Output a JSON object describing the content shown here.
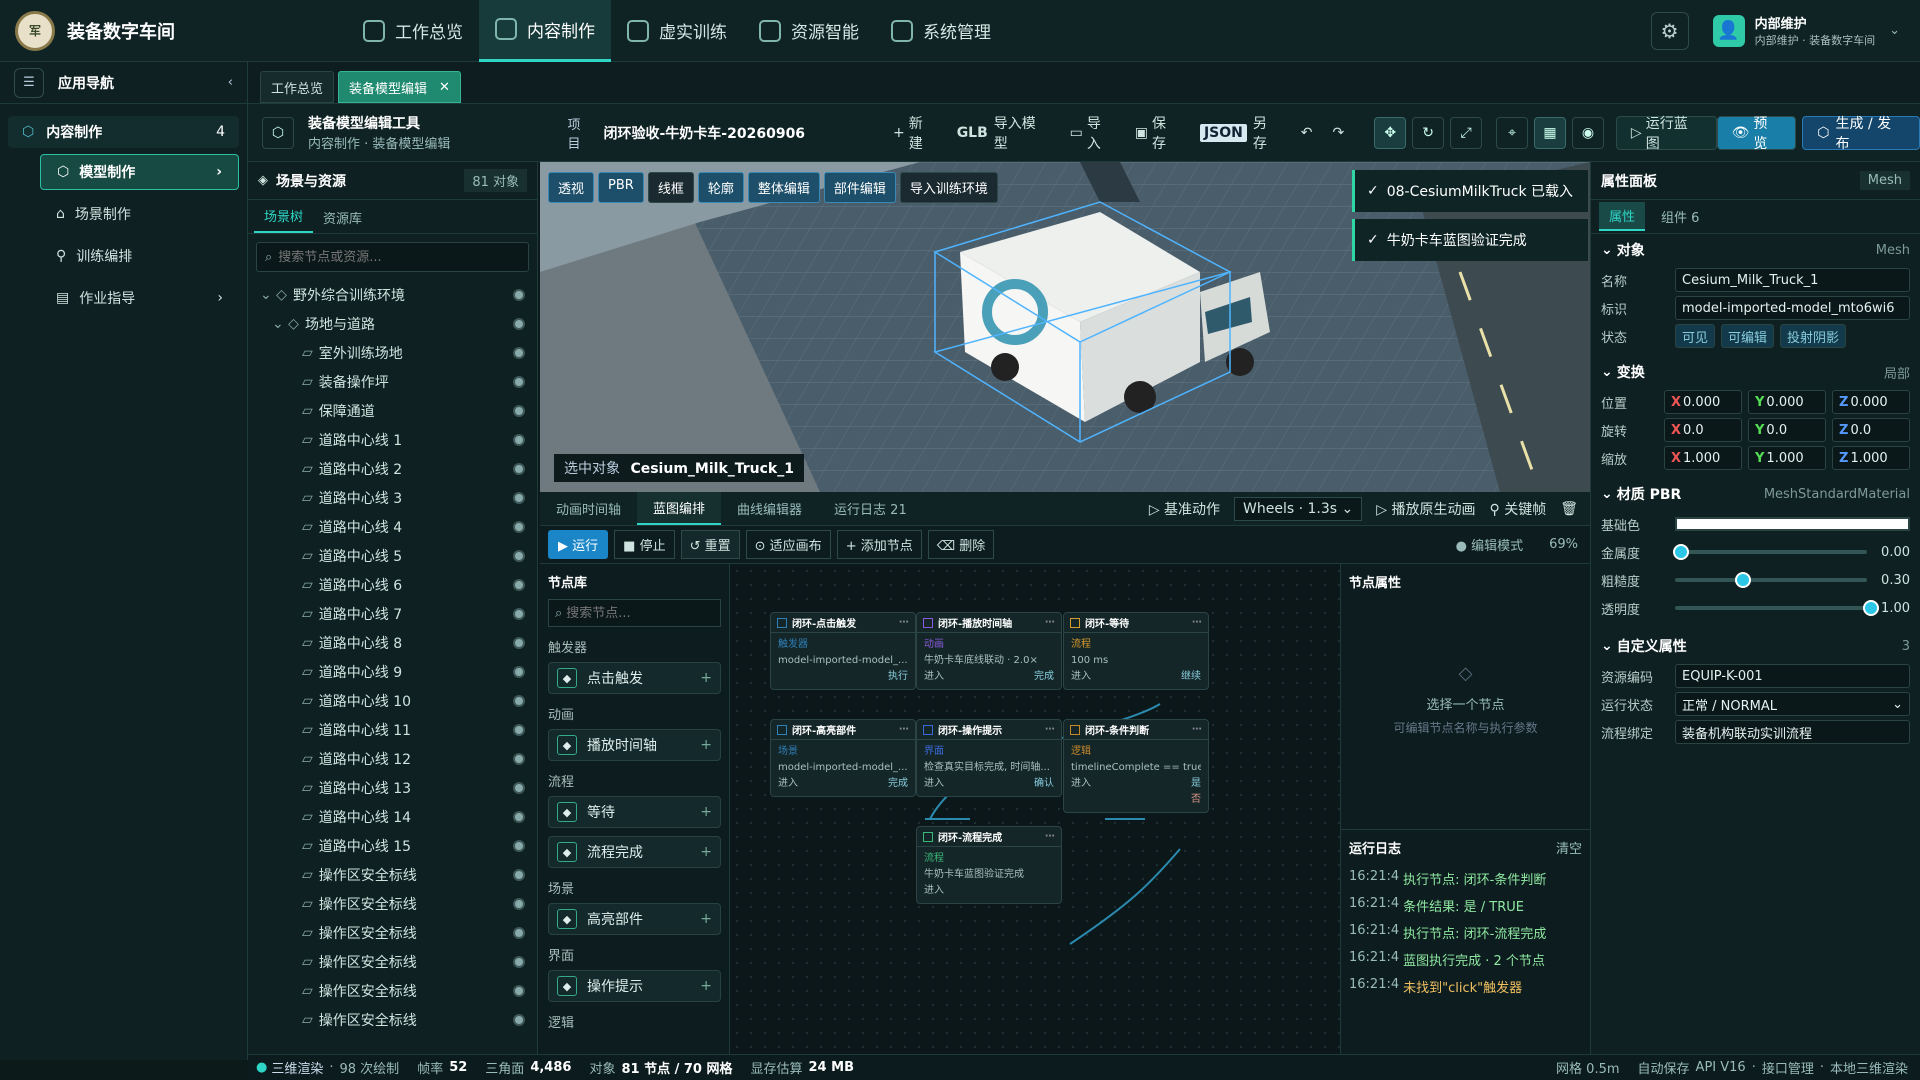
{
  "app": {
    "title": "装备数字车间",
    "logo": "军"
  },
  "topnav": [
    {
      "label": "工作总览"
    },
    {
      "label": "内容制作"
    },
    {
      "label": "虚实训练"
    },
    {
      "label": "资源智能"
    },
    {
      "label": "系统管理"
    }
  ],
  "user": {
    "name": "内部维护",
    "sub": "内部维护 · 装备数字车间"
  },
  "sidebar": {
    "title": "应用导航",
    "group": "内容制作",
    "group_count": "4",
    "items": [
      {
        "label": "模型制作"
      },
      {
        "label": "场景制作"
      },
      {
        "label": "训练编排"
      },
      {
        "label": "作业指导"
      }
    ]
  },
  "tabs": [
    {
      "label": "工作总览"
    },
    {
      "label": "装备模型编辑"
    }
  ],
  "tool": {
    "title": "装备模型编辑工具",
    "crumb": "内容制作 · 装备模型编辑",
    "project_label": "项目",
    "project": "闭环验收-牛奶卡车-20260906",
    "new": "新建",
    "glb": "GLB",
    "glb_import": "导入模型",
    "import": "导入",
    "save": "保存",
    "json": "JSON",
    "saveas": "另存",
    "run_bp": "运行蓝图",
    "preview": "预览",
    "publish": "生成 / 发布"
  },
  "scene": {
    "title": "场景与资源",
    "count": "81 对象",
    "tab1": "场景树",
    "tab2": "资源库",
    "search": "搜索节点或资源...",
    "tree": [
      "野外综合训练环境",
      "场地与道路",
      "室外训练场地",
      "装备操作坪",
      "保障通道",
      "道路中心线 1",
      "道路中心线 2",
      "道路中心线 3",
      "道路中心线 4",
      "道路中心线 5",
      "道路中心线 6",
      "道路中心线 7",
      "道路中心线 8",
      "道路中心线 9",
      "道路中心线 10",
      "道路中心线 11",
      "道路中心线 12",
      "道路中心线 13",
      "道路中心线 14",
      "道路中心线 15",
      "操作区安全标线",
      "操作区安全标线",
      "操作区安全标线",
      "操作区安全标线",
      "操作区安全标线",
      "操作区安全标线"
    ]
  },
  "vp": {
    "modes": [
      "透视",
      "PBR",
      "线框",
      "轮廓",
      "整体编辑",
      "部件编辑",
      "导入训练环境"
    ],
    "selected_label": "选中对象",
    "selected": "Cesium_Milk_Truck_1"
  },
  "toasts": [
    "08-CesiumMilkTruck 已载入",
    "牛奶卡车蓝图验证完成"
  ],
  "btabs": [
    "动画时间轴",
    "蓝图编排",
    "曲线编辑器",
    "运行日志 21"
  ],
  "anim": {
    "base": "基准动作",
    "clip": "Wheels · 1.3s",
    "play": "播放原生动画",
    "key": "关键帧"
  },
  "bp": {
    "run": "运行",
    "stop": "停止",
    "reset": "重置",
    "fit": "适应画布",
    "add": "添加节点",
    "del": "删除",
    "mode": "编辑模式",
    "zoom": "69%"
  },
  "lib": {
    "title": "节点库",
    "search": "搜索节点...",
    "cats": [
      {
        "name": "触发器",
        "items": [
          "点击触发"
        ]
      },
      {
        "name": "动画",
        "items": [
          "播放时间轴"
        ]
      },
      {
        "name": "流程",
        "items": [
          "等待",
          "流程完成"
        ]
      },
      {
        "name": "场景",
        "items": [
          "高亮部件"
        ]
      },
      {
        "name": "界面",
        "items": [
          "操作提示"
        ]
      },
      {
        "name": "逻辑",
        "items": []
      }
    ]
  },
  "nodes": [
    {
      "title": "闭环-点击触发",
      "type": "触发器",
      "text": "model-imported-model_...",
      "out": "执行"
    },
    {
      "title": "闭环-播放时间轴",
      "type": "动画",
      "text": "牛奶卡车底线联动 · 2.0×",
      "in": "进入",
      "out": "完成"
    },
    {
      "title": "闭环-等待",
      "type": "流程",
      "text": "100 ms",
      "in": "进入",
      "out": "继续"
    },
    {
      "title": "闭环-高亮部件",
      "type": "场景",
      "text": "model-imported-model_...",
      "in": "进入",
      "out": "完成"
    },
    {
      "title": "闭环-操作提示",
      "type": "界面",
      "text": "检查真实目标完成, 时间轴...",
      "in": "进入",
      "out": "确认"
    },
    {
      "title": "闭环-条件判断",
      "type": "逻辑",
      "text": "timelineComplete == true",
      "in": "进入",
      "out": "是",
      "out2": "否"
    },
    {
      "title": "闭环-流程完成",
      "type": "流程",
      "text": "牛奶卡车蓝图验证完成",
      "in": "进入"
    }
  ],
  "nprops": {
    "title": "节点属性",
    "empty": "选择一个节点",
    "hint": "可编辑节点名称与执行参数"
  },
  "log": {
    "title": "运行日志",
    "clear": "清空",
    "lines": [
      {
        "t": "16:21:4",
        "m": "执行节点: 闭环-条件判断"
      },
      {
        "t": "16:21:4",
        "m": "条件结果: 是 / TRUE"
      },
      {
        "t": "16:21:4",
        "m": "执行节点: 闭环-流程完成"
      },
      {
        "t": "16:21:4",
        "m": "蓝图执行完成 · 2 个节点"
      },
      {
        "t": "16:21:4",
        "m": "未找到\"click\"触发器"
      }
    ]
  },
  "props": {
    "title": "属性面板",
    "kind": "Mesh",
    "tab1": "属性",
    "tab2": "组件 6",
    "obj": "对象",
    "obj_r": "Mesh",
    "name_l": "名称",
    "name": "Cesium_Milk_Truck_1",
    "id_l": "标识",
    "id": "model-imported-model_mto6wi6",
    "state_l": "状态",
    "states": [
      "可见",
      "可编辑",
      "投射阴影"
    ],
    "tf": "变换",
    "tf_r": "局部",
    "pos_l": "位置",
    "rot_l": "旋转",
    "scl_l": "缩放",
    "pos": [
      "0.000",
      "0.000",
      "0.000"
    ],
    "rot": [
      "0.0",
      "0.0",
      "0.0"
    ],
    "scl": [
      "1.000",
      "1.000",
      "1.000"
    ],
    "mat": "材质 PBR",
    "mat_r": "MeshStandardMaterial",
    "base_l": "基础色",
    "metal_l": "金属度",
    "metal": "0.00",
    "rough_l": "粗糙度",
    "rough": "0.30",
    "opac_l": "透明度",
    "opac": "1.00",
    "custom": "自定义属性",
    "custom_n": "3",
    "code_l": "资源编码",
    "code": "EQUIP-K-001",
    "run_l": "运行状态",
    "run": "正常 / NORMAL",
    "flow_l": "流程绑定",
    "flow": "装备机构联动实训流程"
  },
  "status": {
    "render": "三维渲染",
    "draws": "98 次绘制",
    "fps_l": "帧率",
    "fps": "52",
    "tri_l": "三角面",
    "tri": "4,486",
    "obj_l": "对象",
    "obj": "81 节点 / 70 网格",
    "mem_l": "显存估算",
    "mem": "24 MB",
    "grid": "网格 0.5m",
    "autosave": "自动保存",
    "api": "API V16",
    "port": "接口管理",
    "local": "本地三维渲染"
  },
  "colors": {
    "accent": "#2fd5c5",
    "primary": "#1f8a70"
  }
}
